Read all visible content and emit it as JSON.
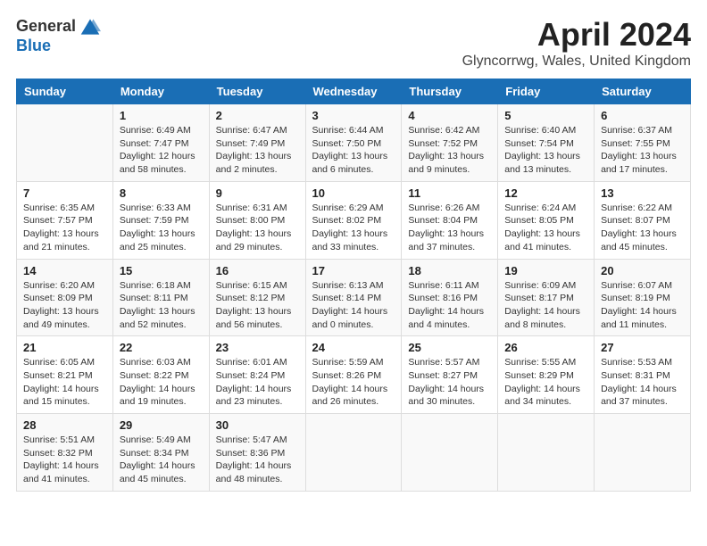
{
  "header": {
    "logo_general": "General",
    "logo_blue": "Blue",
    "title": "April 2024",
    "subtitle": "Glyncorrwg, Wales, United Kingdom"
  },
  "columns": [
    "Sunday",
    "Monday",
    "Tuesday",
    "Wednesday",
    "Thursday",
    "Friday",
    "Saturday"
  ],
  "weeks": [
    [
      {
        "day": "",
        "info": ""
      },
      {
        "day": "1",
        "info": "Sunrise: 6:49 AM\nSunset: 7:47 PM\nDaylight: 12 hours\nand 58 minutes."
      },
      {
        "day": "2",
        "info": "Sunrise: 6:47 AM\nSunset: 7:49 PM\nDaylight: 13 hours\nand 2 minutes."
      },
      {
        "day": "3",
        "info": "Sunrise: 6:44 AM\nSunset: 7:50 PM\nDaylight: 13 hours\nand 6 minutes."
      },
      {
        "day": "4",
        "info": "Sunrise: 6:42 AM\nSunset: 7:52 PM\nDaylight: 13 hours\nand 9 minutes."
      },
      {
        "day": "5",
        "info": "Sunrise: 6:40 AM\nSunset: 7:54 PM\nDaylight: 13 hours\nand 13 minutes."
      },
      {
        "day": "6",
        "info": "Sunrise: 6:37 AM\nSunset: 7:55 PM\nDaylight: 13 hours\nand 17 minutes."
      }
    ],
    [
      {
        "day": "7",
        "info": "Sunrise: 6:35 AM\nSunset: 7:57 PM\nDaylight: 13 hours\nand 21 minutes."
      },
      {
        "day": "8",
        "info": "Sunrise: 6:33 AM\nSunset: 7:59 PM\nDaylight: 13 hours\nand 25 minutes."
      },
      {
        "day": "9",
        "info": "Sunrise: 6:31 AM\nSunset: 8:00 PM\nDaylight: 13 hours\nand 29 minutes."
      },
      {
        "day": "10",
        "info": "Sunrise: 6:29 AM\nSunset: 8:02 PM\nDaylight: 13 hours\nand 33 minutes."
      },
      {
        "day": "11",
        "info": "Sunrise: 6:26 AM\nSunset: 8:04 PM\nDaylight: 13 hours\nand 37 minutes."
      },
      {
        "day": "12",
        "info": "Sunrise: 6:24 AM\nSunset: 8:05 PM\nDaylight: 13 hours\nand 41 minutes."
      },
      {
        "day": "13",
        "info": "Sunrise: 6:22 AM\nSunset: 8:07 PM\nDaylight: 13 hours\nand 45 minutes."
      }
    ],
    [
      {
        "day": "14",
        "info": "Sunrise: 6:20 AM\nSunset: 8:09 PM\nDaylight: 13 hours\nand 49 minutes."
      },
      {
        "day": "15",
        "info": "Sunrise: 6:18 AM\nSunset: 8:11 PM\nDaylight: 13 hours\nand 52 minutes."
      },
      {
        "day": "16",
        "info": "Sunrise: 6:15 AM\nSunset: 8:12 PM\nDaylight: 13 hours\nand 56 minutes."
      },
      {
        "day": "17",
        "info": "Sunrise: 6:13 AM\nSunset: 8:14 PM\nDaylight: 14 hours\nand 0 minutes."
      },
      {
        "day": "18",
        "info": "Sunrise: 6:11 AM\nSunset: 8:16 PM\nDaylight: 14 hours\nand 4 minutes."
      },
      {
        "day": "19",
        "info": "Sunrise: 6:09 AM\nSunset: 8:17 PM\nDaylight: 14 hours\nand 8 minutes."
      },
      {
        "day": "20",
        "info": "Sunrise: 6:07 AM\nSunset: 8:19 PM\nDaylight: 14 hours\nand 11 minutes."
      }
    ],
    [
      {
        "day": "21",
        "info": "Sunrise: 6:05 AM\nSunset: 8:21 PM\nDaylight: 14 hours\nand 15 minutes."
      },
      {
        "day": "22",
        "info": "Sunrise: 6:03 AM\nSunset: 8:22 PM\nDaylight: 14 hours\nand 19 minutes."
      },
      {
        "day": "23",
        "info": "Sunrise: 6:01 AM\nSunset: 8:24 PM\nDaylight: 14 hours\nand 23 minutes."
      },
      {
        "day": "24",
        "info": "Sunrise: 5:59 AM\nSunset: 8:26 PM\nDaylight: 14 hours\nand 26 minutes."
      },
      {
        "day": "25",
        "info": "Sunrise: 5:57 AM\nSunset: 8:27 PM\nDaylight: 14 hours\nand 30 minutes."
      },
      {
        "day": "26",
        "info": "Sunrise: 5:55 AM\nSunset: 8:29 PM\nDaylight: 14 hours\nand 34 minutes."
      },
      {
        "day": "27",
        "info": "Sunrise: 5:53 AM\nSunset: 8:31 PM\nDaylight: 14 hours\nand 37 minutes."
      }
    ],
    [
      {
        "day": "28",
        "info": "Sunrise: 5:51 AM\nSunset: 8:32 PM\nDaylight: 14 hours\nand 41 minutes."
      },
      {
        "day": "29",
        "info": "Sunrise: 5:49 AM\nSunset: 8:34 PM\nDaylight: 14 hours\nand 45 minutes."
      },
      {
        "day": "30",
        "info": "Sunrise: 5:47 AM\nSunset: 8:36 PM\nDaylight: 14 hours\nand 48 minutes."
      },
      {
        "day": "",
        "info": ""
      },
      {
        "day": "",
        "info": ""
      },
      {
        "day": "",
        "info": ""
      },
      {
        "day": "",
        "info": ""
      }
    ]
  ]
}
